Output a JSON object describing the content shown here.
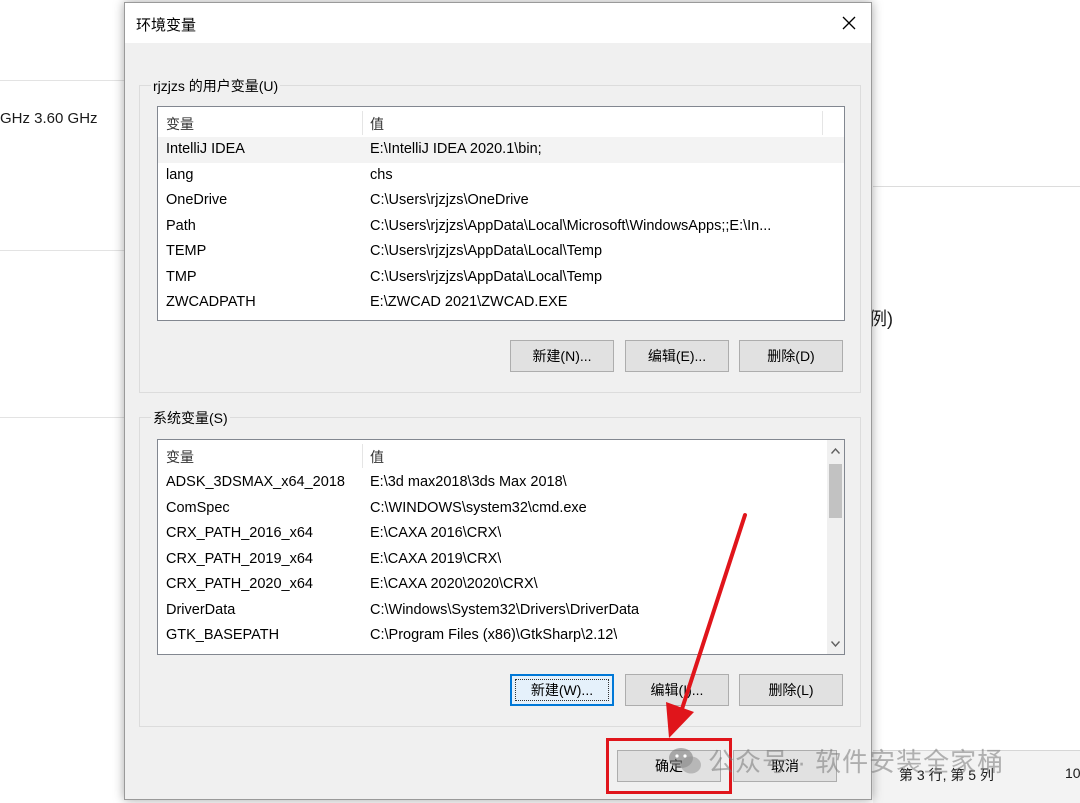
{
  "background": {
    "cpu_text": "GHz   3.60 GHz",
    "right_text": "j例)",
    "status_text": "第 3 行, 第 5 列",
    "status_num": "10"
  },
  "dialog": {
    "title": "环境变量",
    "user_section": {
      "label": "rjzjzs 的用户变量(U)",
      "col_name": "变量",
      "col_value": "值",
      "rows": [
        {
          "name": "IntelliJ IDEA",
          "value": "E:\\IntelliJ IDEA 2020.1\\bin;"
        },
        {
          "name": "lang",
          "value": "chs"
        },
        {
          "name": "OneDrive",
          "value": "C:\\Users\\rjzjzs\\OneDrive"
        },
        {
          "name": "Path",
          "value": "C:\\Users\\rjzjzs\\AppData\\Local\\Microsoft\\WindowsApps;;E:\\In..."
        },
        {
          "name": "TEMP",
          "value": "C:\\Users\\rjzjzs\\AppData\\Local\\Temp"
        },
        {
          "name": "TMP",
          "value": "C:\\Users\\rjzjzs\\AppData\\Local\\Temp"
        },
        {
          "name": "ZWCADPATH",
          "value": "E:\\ZWCAD 2021\\ZWCAD.EXE"
        }
      ],
      "buttons": {
        "new": "新建(N)...",
        "edit": "编辑(E)...",
        "delete": "删除(D)"
      }
    },
    "system_section": {
      "label": "系统变量(S)",
      "col_name": "变量",
      "col_value": "值",
      "rows": [
        {
          "name": "ADSK_3DSMAX_x64_2018",
          "value": "E:\\3d max2018\\3ds Max 2018\\"
        },
        {
          "name": "ComSpec",
          "value": "C:\\WINDOWS\\system32\\cmd.exe"
        },
        {
          "name": "CRX_PATH_2016_x64",
          "value": "E:\\CAXA 2016\\CRX\\"
        },
        {
          "name": "CRX_PATH_2019_x64",
          "value": "E:\\CAXA 2019\\CRX\\"
        },
        {
          "name": "CRX_PATH_2020_x64",
          "value": "E:\\CAXA 2020\\2020\\CRX\\"
        },
        {
          "name": "DriverData",
          "value": "C:\\Windows\\System32\\Drivers\\DriverData"
        },
        {
          "name": "GTK_BASEPATH",
          "value": "C:\\Program Files (x86)\\GtkSharp\\2.12\\"
        }
      ],
      "buttons": {
        "new": "新建(W)...",
        "edit": "编辑(I)...",
        "delete": "删除(L)"
      }
    },
    "ok_label": "确定",
    "cancel_label": "取消"
  },
  "watermark": "公众号 · 软件安装全家桶",
  "colors": {
    "annotation_red": "#e0151b",
    "focus_blue": "#0078d7"
  }
}
